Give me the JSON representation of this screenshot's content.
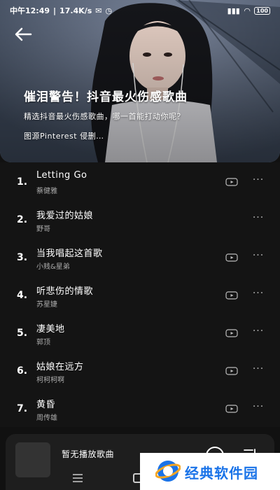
{
  "status_bar": {
    "time": "中午12:49",
    "speed": "17.4K/s",
    "battery": "100"
  },
  "hero": {
    "title": "催泪警告！抖音最火伤感歌曲",
    "subtitle": "精选抖音最火伤感歌曲，哪一首能打动你呢？",
    "credit": "图源Pinterest 侵删…"
  },
  "songs": [
    {
      "num": "1.",
      "title": "Letting Go",
      "artist": "蔡健雅",
      "has_mv": true
    },
    {
      "num": "2.",
      "title": "我爱过的姑娘",
      "artist": "野哥",
      "has_mv": false
    },
    {
      "num": "3.",
      "title": "当我唱起这首歌",
      "artist": "小贱&星弟",
      "has_mv": true
    },
    {
      "num": "4.",
      "title": "听悲伤的情歌",
      "artist": "苏星婕",
      "has_mv": true
    },
    {
      "num": "5.",
      "title": "凄美地",
      "artist": "郭顶",
      "has_mv": true
    },
    {
      "num": "6.",
      "title": "姑娘在远方",
      "artist": "柯柯柯啊",
      "has_mv": true
    },
    {
      "num": "7.",
      "title": "黄昏",
      "artist": "周传雄",
      "has_mv": true
    }
  ],
  "player": {
    "status": "暂无播放歌曲"
  },
  "watermark": {
    "text": "经典软件园"
  },
  "icons": {
    "back": "arrow-left-icon",
    "mv": "video-icon",
    "more": "more-dots-icon",
    "play": "play-circle-icon",
    "playlist": "playlist-icon"
  },
  "colors": {
    "background": "#141414",
    "player_bar": "#1e1e1e",
    "text_primary": "#ffffff",
    "text_secondary": "#aaaaaa",
    "watermark_blue": "#1a73e8"
  }
}
